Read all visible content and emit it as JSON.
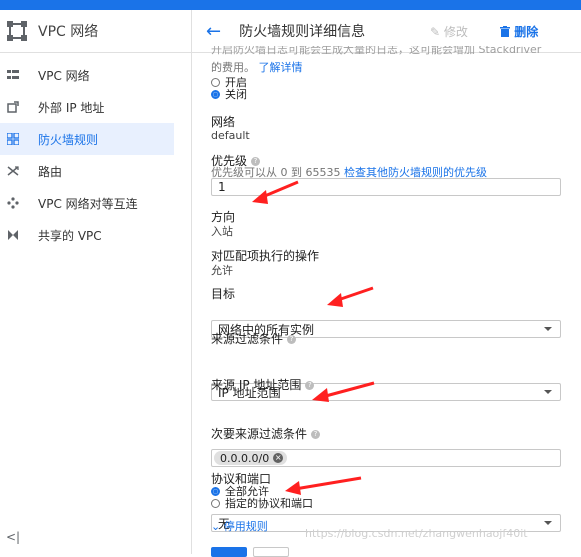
{
  "sidebar": {
    "title": "VPC 网络",
    "items": [
      {
        "label": "VPC 网络",
        "icon": "vpc-network-icon"
      },
      {
        "label": "外部 IP 地址",
        "icon": "external-ip-icon"
      },
      {
        "label": "防火墙规则",
        "icon": "firewall-icon",
        "active": true
      },
      {
        "label": "路由",
        "icon": "routes-icon"
      },
      {
        "label": "VPC 网络对等互连",
        "icon": "peering-icon"
      },
      {
        "label": "共享的 VPC",
        "icon": "shared-vpc-icon"
      }
    ],
    "collapse_glyph": "<|"
  },
  "header": {
    "back_glyph": "←",
    "title": "防火墙规则详细信息",
    "edit_label": "修改",
    "delete_label": "删除"
  },
  "logs": {
    "text_line1": "开启防火墙日志可能会生成大量的日志，这可能会增加 Stackdriver",
    "text_line2": "的费用。",
    "link": "了解详情",
    "options": [
      "开启",
      "关闭"
    ],
    "selected": "关闭"
  },
  "network": {
    "label": "网络",
    "value": "default"
  },
  "priority": {
    "label": "优先级",
    "help_text": "优先级可以从 0 到 65535",
    "link": "检查其他防火墙规则的优先级",
    "value": "1"
  },
  "direction": {
    "label": "方向",
    "value": "入站"
  },
  "action": {
    "label": "对匹配项执行的操作",
    "value": "允许"
  },
  "target": {
    "label": "目标",
    "value": "网络中的所有实例"
  },
  "source_filter": {
    "label": "来源过滤条件",
    "value": "IP 地址范围"
  },
  "source_ip": {
    "label": "来源 IP 地址范围",
    "chip": "0.0.0.0/0"
  },
  "secondary_filter": {
    "label": "次要来源过滤条件",
    "value": "无"
  },
  "protocols": {
    "label": "协议和端口",
    "options": [
      "全部允许",
      "指定的协议和端口"
    ],
    "selected": "全部允许"
  },
  "disable_rule": {
    "label": "停用规则"
  },
  "watermark": "https://blog.csdn.net/zhangwenhaojf40it",
  "colors": {
    "accent": "#1a73e8",
    "annotation_arrow": "#ff2020"
  }
}
